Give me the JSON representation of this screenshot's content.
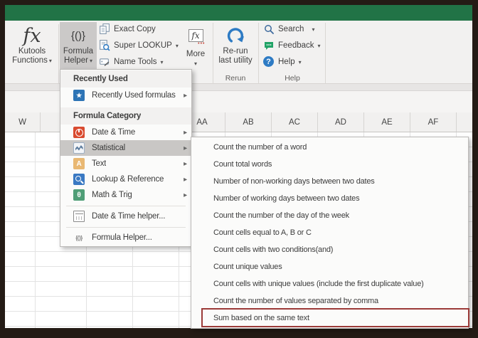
{
  "titlebar": {
    "color": "#217346"
  },
  "ribbon": {
    "kutools_functions": {
      "line1": "Kutools",
      "line2": "Functions"
    },
    "formula_helper": {
      "line1": "Formula",
      "line2": "Helper"
    },
    "exact_copy": {
      "label": "Exact Copy"
    },
    "super_lookup": {
      "label": "Super LOOKUP"
    },
    "name_tools": {
      "label": "Name Tools"
    },
    "more": {
      "label": "More"
    },
    "rerun_button": {
      "line1": "Re-run",
      "line2": "last utility"
    },
    "search": {
      "label": "Search"
    },
    "feedback": {
      "label": "Feedback"
    },
    "help": {
      "label": "Help"
    },
    "group_labels": {
      "rerun": "Rerun",
      "help": "Help"
    }
  },
  "grid": {
    "column_headers": [
      "W",
      "AA",
      "AB",
      "AC",
      "AD",
      "AE",
      "AF"
    ]
  },
  "formula_helper_menu": {
    "entries": [
      {
        "type": "header",
        "label": "Recently Used"
      },
      {
        "type": "item",
        "label": "Recently Used formulas",
        "icon": "star",
        "arrow": true
      },
      {
        "type": "header",
        "label": "Formula Category"
      },
      {
        "type": "item",
        "label": "Date & Time",
        "icon": "clock",
        "arrow": true
      },
      {
        "type": "item",
        "label": "Statistical",
        "icon": "chart",
        "arrow": true,
        "highlighted": true
      },
      {
        "type": "item",
        "label": "Text",
        "icon": "letter-a",
        "arrow": true
      },
      {
        "type": "item",
        "label": "Lookup & Reference",
        "icon": "magnifier",
        "arrow": true
      },
      {
        "type": "item",
        "label": "Math & Trig",
        "icon": "theta",
        "arrow": true
      },
      {
        "type": "separator"
      },
      {
        "type": "item",
        "label": "Date & Time helper...",
        "icon": "calendar",
        "arrow": false
      },
      {
        "type": "separator"
      },
      {
        "type": "item",
        "label": "Formula Helper...",
        "icon": "braces",
        "arrow": false
      }
    ]
  },
  "statistical_submenu": {
    "items": [
      "Count the number of a word",
      "Count total words",
      "Number of non-working days between two dates",
      "Number of working days between two dates",
      "Count the number of the day of the week",
      "Count cells equal to A, B or C",
      "Count cells with two conditions(and)",
      "Count unique values",
      "Count cells with unique values (include the first duplicate value)",
      "Count the number of values separated by comma",
      "Sum based on the same text"
    ],
    "annotation": {
      "target": "Sum based on the same text",
      "color": "#9b3a38"
    }
  },
  "colors": {
    "titlebar_green": "#217346",
    "menu_highlight_gray": "#c9c7c5",
    "annotation_red": "#9b3a38",
    "rerun_arrow_blue": "#2e7bc4",
    "feedback_green": "#21a366"
  },
  "icons": {
    "kutools_functions": "fx",
    "formula_helper": "{()}",
    "star": "blue book with white star",
    "clock": "red book with white clock",
    "chart": "zigzag line chart",
    "letter-a": "tan book with white A",
    "magnifier": "blue book with magnifier",
    "theta": "green book with theta",
    "calendar": "gray calendar outline",
    "braces": "{()} glyph"
  }
}
